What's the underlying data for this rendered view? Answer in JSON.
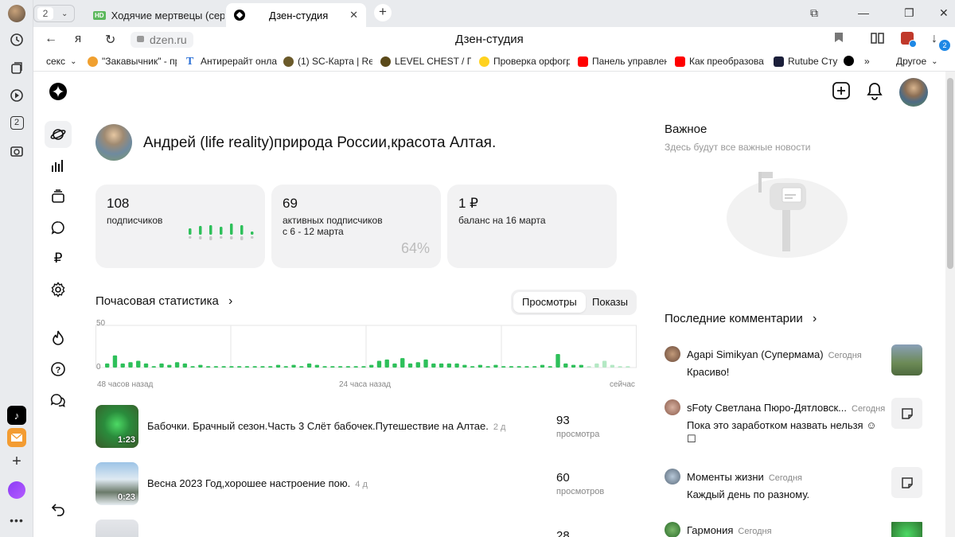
{
  "browser": {
    "tab_count": "2",
    "tabs": [
      {
        "label": "Ходячие мертвецы (сериа",
        "badge": "HD"
      },
      {
        "label": "Дзен-студия"
      }
    ],
    "url": "dzen.ru",
    "page_title": "Дзен-студия",
    "bookmarks": [
      {
        "label": "секс"
      },
      {
        "label": "\"Закавычник\" - пр"
      },
      {
        "label": "Антирерайт онла"
      },
      {
        "label": "(1) SC-Карта | Re"
      },
      {
        "label": "LEVEL CHEST / Пс"
      },
      {
        "label": "Проверка орфогр"
      },
      {
        "label": "Панель управлен"
      },
      {
        "label": "Как преобразоват"
      },
      {
        "label": "Rutube Сту"
      }
    ],
    "bookmarks_more": "»",
    "bookmarks_other": "Другое",
    "downloads_badge": "2",
    "rail_badge": "2"
  },
  "profile": {
    "name": "Андрей (life reality)природа России,красота Алтая."
  },
  "stats": {
    "subscribers": {
      "value": "108",
      "label": "подписчиков",
      "sparkline": [
        0.4,
        0.55,
        0.6,
        0.5,
        0.7,
        0.6,
        0.2
      ]
    },
    "active": {
      "value": "69",
      "label1": "активных подписчиков",
      "label2": "с 6 - 12 марта",
      "percent": "64%"
    },
    "balance": {
      "value": "1 ₽",
      "label": "баланс на 16 марта"
    }
  },
  "hourly": {
    "title": "Почасовая статистика",
    "toggle_views": "Просмотры",
    "toggle_shows": "Показы",
    "y_max": "50",
    "y_min": "0",
    "x_left": "48 часов назад",
    "x_mid": "24 часа назад",
    "x_right": "сейчас"
  },
  "chart_data": {
    "type": "bar",
    "title": "Почасовая статистика",
    "ylim": [
      0,
      50
    ],
    "x_ticks": [
      "48 часов назад",
      "24 часа назад",
      "сейчас"
    ],
    "values": [
      3,
      9,
      3,
      4,
      5,
      3,
      1,
      3,
      2,
      4,
      3,
      1,
      2,
      1,
      1,
      1,
      1,
      1,
      1,
      1,
      1,
      1,
      2,
      1,
      2,
      1,
      3,
      2,
      1,
      1,
      1,
      1,
      1,
      1,
      2,
      5,
      6,
      3,
      7,
      3,
      4,
      6,
      3,
      3,
      3,
      3,
      2,
      1,
      2,
      1,
      2,
      1,
      1,
      1,
      1,
      1,
      2,
      1,
      10,
      3,
      2,
      2,
      1,
      3,
      5,
      2,
      1,
      1
    ],
    "faded_from_index": 62
  },
  "publications": [
    {
      "title": "Бабочки. Брачный сезон.Часть 3 Слёт бабочек.Путешествие на Алтае.",
      "age": "2 д",
      "duration": "1:23",
      "views": "93",
      "views_label": "просмотра"
    },
    {
      "title": "Весна 2023 Год,хорошее настроение пою.",
      "age": "4 д",
      "duration": "0:23",
      "views": "60",
      "views_label": "просмотров"
    },
    {
      "title": "",
      "age": "",
      "duration": "",
      "views": "28",
      "views_label": ""
    }
  ],
  "important": {
    "title": "Важное",
    "subtitle": "Здесь будут все важные новости"
  },
  "comments": {
    "title": "Последние комментарии",
    "items": [
      {
        "author": "Agapi Simikyan (Супермама)",
        "when": "Сегодня",
        "text": "Красиво!"
      },
      {
        "author": "sFoty Светлана Пюро-Дятловск...",
        "when": "Сегодня",
        "text": "Пока это заработком назвать нельзя ☺",
        "text2": "☐"
      },
      {
        "author": "Моменты жизни",
        "when": "Сегодня",
        "text": "Каждый день по разному."
      },
      {
        "author": "Гармония",
        "when": "Сегодня",
        "text": ""
      }
    ]
  },
  "colors": {
    "accent_green": "#2ec05a",
    "faded_green": "#b4e8c4",
    "card_bg": "#f2f2f3"
  }
}
